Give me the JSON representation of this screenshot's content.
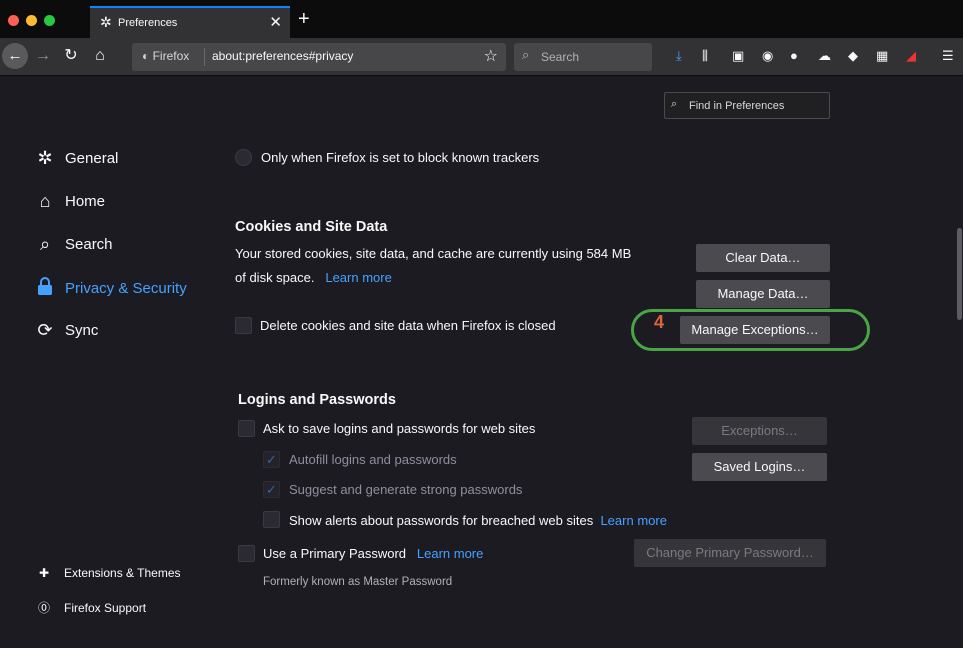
{
  "tab": {
    "title": "Preferences",
    "icon": "gear-icon"
  },
  "nav": {
    "identity": "Firefox",
    "url": "about:preferences#privacy",
    "search_placeholder": "Search"
  },
  "find": {
    "placeholder": "Find in Preferences"
  },
  "sidebar": {
    "items": [
      {
        "label": "General",
        "icon": "gear-icon"
      },
      {
        "label": "Home",
        "icon": "home-icon"
      },
      {
        "label": "Search",
        "icon": "search-icon"
      },
      {
        "label": "Privacy & Security",
        "icon": "lock-icon"
      },
      {
        "label": "Sync",
        "icon": "sync-icon"
      }
    ],
    "footer": [
      {
        "label": "Extensions & Themes",
        "icon": "puzzle-icon"
      },
      {
        "label": "Firefox Support",
        "icon": "help-icon"
      }
    ]
  },
  "tracking": {
    "radio_label": "Only when Firefox is set to block known trackers"
  },
  "cookies": {
    "heading": "Cookies and Site Data",
    "desc_line1": "Your stored cookies, site data, and cache are currently using 584 MB",
    "desc_line2": "of disk space.",
    "learn_more": "Learn more",
    "delete_label": "Delete cookies and site data when Firefox is closed",
    "clear_button": "Clear Data…",
    "manage_data_button": "Manage Data…",
    "manage_exceptions_button": "Manage Exceptions…",
    "step_number": "4"
  },
  "logins": {
    "heading": "Logins and Passwords",
    "ask_save": "Ask to save logins and passwords for web sites",
    "autofill": "Autofill logins and passwords",
    "suggest": "Suggest and generate strong passwords",
    "alerts": "Show alerts about passwords for breached web sites",
    "alerts_learn_more": "Learn more",
    "primary_password": "Use a Primary Password",
    "primary_learn_more": "Learn more",
    "formerly": "Formerly known as Master Password",
    "exceptions_button": "Exceptions…",
    "saved_logins_button": "Saved Logins…",
    "change_primary_button": "Change Primary Password…"
  },
  "colors": {
    "accent": "#45a1ff",
    "highlight": "#4aa645",
    "step": "#e0643a",
    "background": "#1c1b22"
  }
}
